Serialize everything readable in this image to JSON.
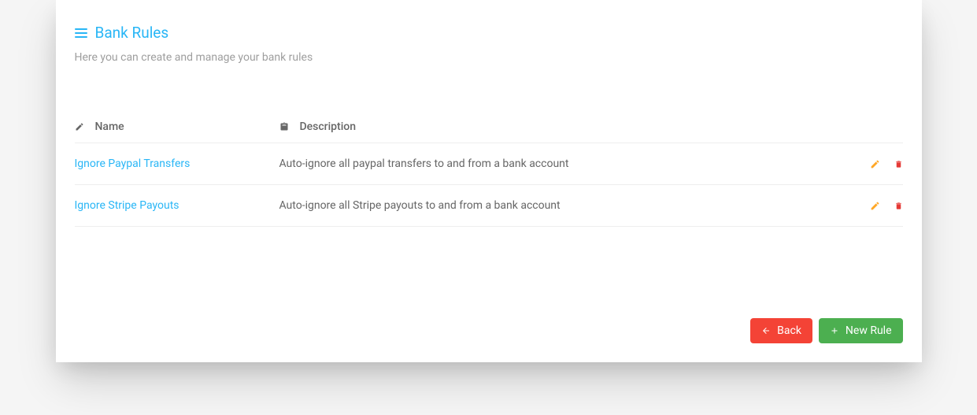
{
  "header": {
    "title": "Bank Rules",
    "subtitle": "Here you can create and manage your bank rules"
  },
  "table": {
    "columns": {
      "name": "Name",
      "description": "Description"
    },
    "rows": [
      {
        "name": "Ignore Paypal Transfers",
        "description": "Auto-ignore all paypal transfers to and from a bank account"
      },
      {
        "name": "Ignore Stripe Payouts",
        "description": "Auto-ignore all Stripe payouts to and from a bank account"
      }
    ]
  },
  "footer": {
    "back_label": "Back",
    "new_rule_label": "New Rule"
  }
}
